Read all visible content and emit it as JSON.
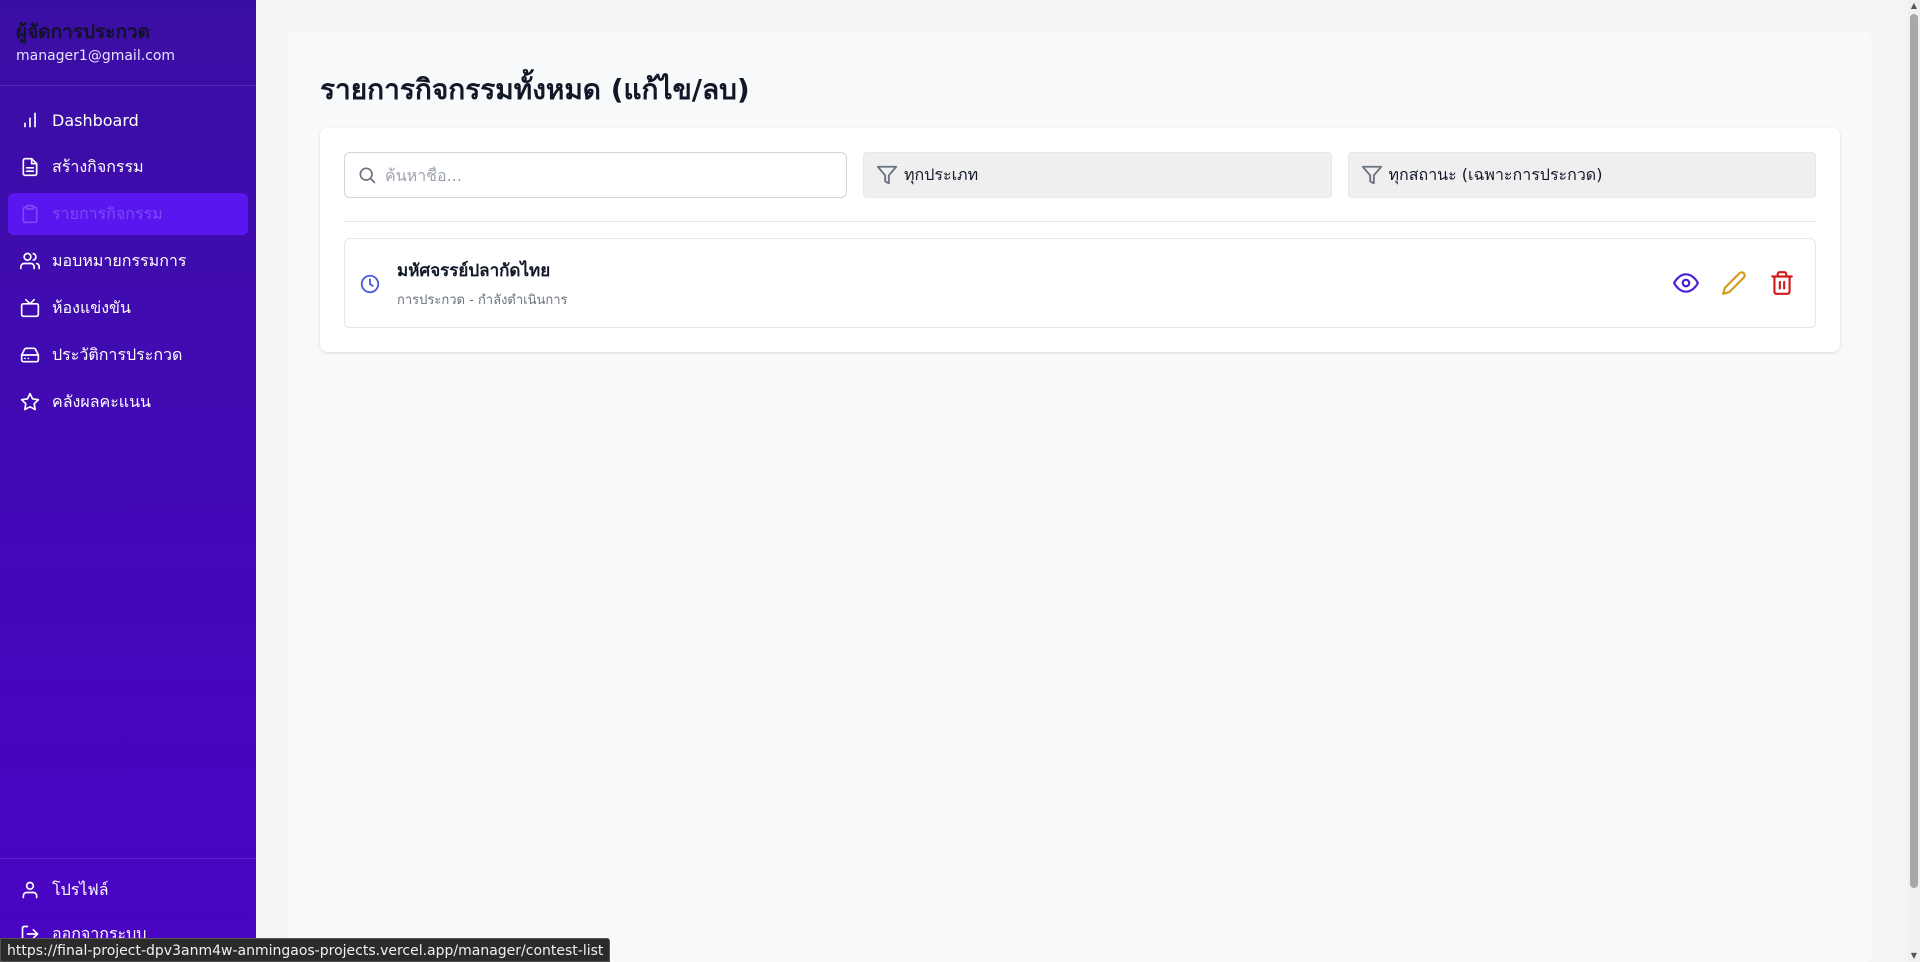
{
  "sidebar": {
    "title": "ผู้จัดการประกวด",
    "email": "manager1@gmail.com",
    "items": [
      {
        "label": "Dashboard",
        "icon": "bar-chart-icon"
      },
      {
        "label": "สร้างกิจกรรม",
        "icon": "document-icon"
      },
      {
        "label": "รายการกิจกรรม",
        "icon": "clipboard-icon",
        "active": true
      },
      {
        "label": "มอบหมายกรรมการ",
        "icon": "users-icon"
      },
      {
        "label": "ห้องแข่งขัน",
        "icon": "tv-icon"
      },
      {
        "label": "ประวัติการประกวด",
        "icon": "hard-drive-icon"
      },
      {
        "label": "คลังผลคะแนน",
        "icon": "star-icon"
      }
    ],
    "bottom": [
      {
        "label": "โปรไฟล์",
        "icon": "user-icon"
      },
      {
        "label": "ออกจากระบบ",
        "icon": "logout-icon"
      }
    ]
  },
  "main": {
    "title": "รายการกิจกรรมทั้งหมด (แก้ไข/ลบ)",
    "search": {
      "placeholder": "ค้นหาชื่อ...",
      "value": ""
    },
    "filter_type": "ทุกประเภท",
    "filter_status": "ทุกสถานะ (เฉพาะการประกวด)",
    "items": [
      {
        "title": "มหัศจรรย์ปลากัดไทย",
        "subtitle": "การประกวด - กำลังดำเนินการ"
      }
    ]
  },
  "status_bar": {
    "url": "https://final-project-dpv3anm4w-anmingaos-projects.vercel.app/manager/contest-list"
  },
  "colors": {
    "sidebar": "#4309b8",
    "active": "#5a16ef",
    "view": "#4c1ed8",
    "edit": "#d49a1a",
    "delete": "#d21a1a"
  }
}
